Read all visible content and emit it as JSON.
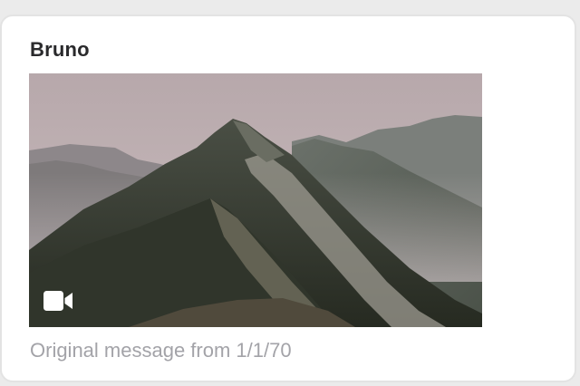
{
  "message": {
    "sender": "Bruno",
    "caption": "Original message from 1/1/70",
    "attachment": {
      "kind": "video",
      "badge_icon": "video-camera-icon"
    }
  },
  "colors": {
    "background": "#ebebeb",
    "card": "#ffffff",
    "sender_text": "#2a2a2c",
    "caption_text": "#a3a3a8"
  }
}
